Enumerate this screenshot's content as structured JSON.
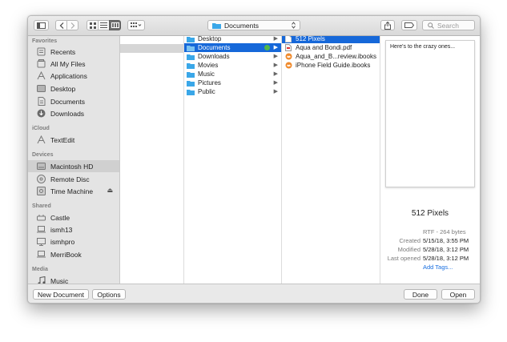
{
  "toolbar": {
    "path_folder": "Documents",
    "search_placeholder": "Search"
  },
  "sidebar": {
    "sections": [
      {
        "title": "Favorites",
        "items": [
          "Recents",
          "All My Files",
          "Applications",
          "Desktop",
          "Documents",
          "Downloads"
        ]
      },
      {
        "title": "iCloud",
        "items": [
          "TextEdit"
        ]
      },
      {
        "title": "Devices",
        "items": [
          "Macintosh HD",
          "Remote Disc",
          "Time Machine"
        ]
      },
      {
        "title": "Shared",
        "items": [
          "Castle",
          "ismh13",
          "ismhpro",
          "MerriBook"
        ]
      },
      {
        "title": "Media",
        "items": [
          "Music"
        ]
      }
    ],
    "selected_item": "Macintosh HD",
    "eject_glyph": "⏏"
  },
  "columns": {
    "col2": [
      "Desktop",
      "Documents",
      "Downloads",
      "Movies",
      "Music",
      "Pictures",
      "Public"
    ],
    "col3": [
      "512 Pixels",
      "Aqua and Bondi.pdf",
      "Aqua_and_B...review.ibooks",
      "iPhone Field Guide.ibooks"
    ]
  },
  "preview": {
    "content_text": "Here's to the crazy ones...",
    "title": "512 Pixels",
    "kind": "RTF - 264 bytes",
    "created_label": "Created",
    "created": "5/15/18, 3:55 PM",
    "modified_label": "Modified",
    "modified": "5/28/18, 3:12 PM",
    "last_opened_label": "Last opened",
    "last_opened": "5/28/18, 3:12 PM",
    "add_tags": "Add Tags..."
  },
  "bottom": {
    "new_document": "New Document",
    "options": "Options",
    "done": "Done",
    "open": "Open"
  },
  "colors": {
    "selection": "#1668d9",
    "folder": "#3aa7e8",
    "tag_green": "#50b848",
    "link": "#1a6fe0"
  }
}
